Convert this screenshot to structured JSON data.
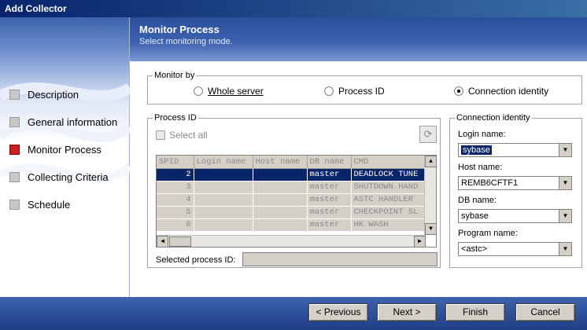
{
  "window": {
    "title": "Add Collector"
  },
  "header": {
    "title": "Monitor Process",
    "subtitle": "Select monitoring mode."
  },
  "sidebar": {
    "items": [
      {
        "label": "Description",
        "active": false
      },
      {
        "label": "General information",
        "active": false
      },
      {
        "label": "Monitor Process",
        "active": true
      },
      {
        "label": "Collecting Criteria",
        "active": false
      },
      {
        "label": "Schedule",
        "active": false
      }
    ]
  },
  "monitor_by": {
    "title": "Monitor by",
    "options": [
      {
        "label": "Whole server",
        "selected": false
      },
      {
        "label": "Process ID",
        "selected": false
      },
      {
        "label": "Connection identity",
        "selected": true
      }
    ]
  },
  "process_id": {
    "title": "Process ID",
    "select_all_label": "Select all",
    "refresh_icon": "refresh-icon",
    "columns": [
      "SPID",
      "Login name",
      "Host name",
      "DB name",
      "CMD"
    ],
    "rows": [
      [
        "2",
        "",
        "",
        "master",
        "DEADLOCK TUNE"
      ],
      [
        "3",
        "",
        "",
        "master",
        "SHUTDOWN HAND"
      ],
      [
        "4",
        "",
        "",
        "master",
        "ASTC HANDLER"
      ],
      [
        "5",
        "",
        "",
        "master",
        "CHECKPOINT SL"
      ],
      [
        "6",
        "",
        "",
        "master",
        "HK WASH"
      ]
    ],
    "selected_row": 0,
    "selected_label": "Selected process ID:",
    "selected_value": ""
  },
  "connection_identity": {
    "title": "Connection identity",
    "login_label": "Login name:",
    "login_value": "sybase",
    "host_label": "Host name:",
    "host_value": "REMB6CFTF1",
    "db_label": "DB name:",
    "db_value": "sybase",
    "program_label": "Program name:",
    "program_value": "<astc>"
  },
  "buttons": {
    "previous": "< Previous",
    "next": "Next >",
    "finish": "Finish",
    "cancel": "Cancel"
  },
  "colors": {
    "title_bar": "#08246b",
    "header": "#3e63b0",
    "active_step": "#cc1f1f",
    "selection": "#0a246a"
  }
}
